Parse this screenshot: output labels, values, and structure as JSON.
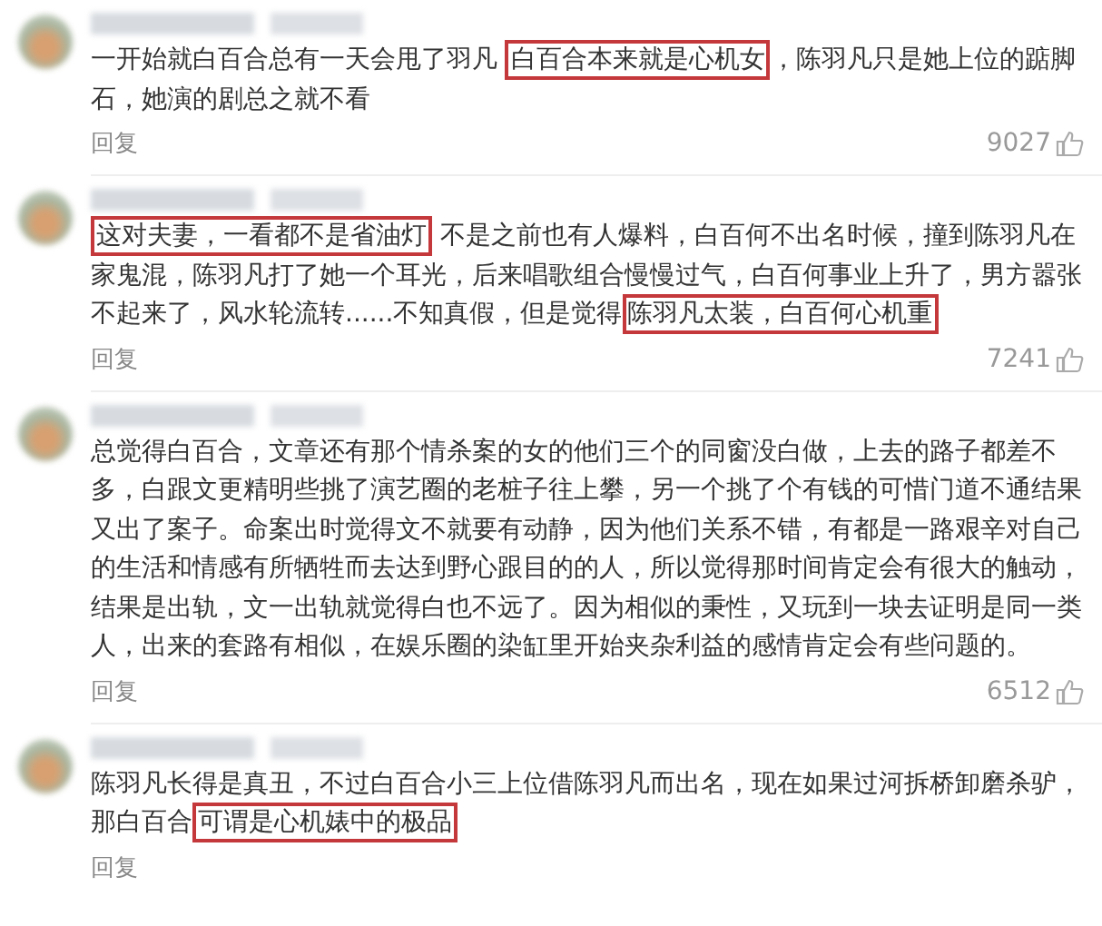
{
  "comments": [
    {
      "segments": [
        {
          "text": "一开始就白百合总有一天会甩了羽凡 ",
          "highlighted": false
        },
        {
          "text": "白百合本来就是心机女",
          "highlighted": true
        },
        {
          "text": "，陈羽凡只是她上位的踮脚石，她演的剧总之就不看",
          "highlighted": false
        }
      ],
      "reply": "回复",
      "likes": "9027"
    },
    {
      "segments": [
        {
          "text": "这对夫妻，一看都不是省油灯",
          "highlighted": true
        },
        {
          "text": " 不是之前也有人爆料，白百何不出名时候，撞到陈羽凡在家鬼混，陈羽凡打了她一个耳光，后来唱歌组合慢慢过气，白百何事业上升了，男方嚣张不起来了，风水轮流转......不知真假，但是觉得",
          "highlighted": false
        },
        {
          "text": "陈羽凡太装，白百何心机重",
          "highlighted": true
        }
      ],
      "reply": "回复",
      "likes": "7241"
    },
    {
      "segments": [
        {
          "text": "总觉得白百合，文章还有那个情杀案的女的他们三个的同窗没白做，上去的路子都差不多，白跟文更精明些挑了演艺圈的老桩子往上攀，另一个挑了个有钱的可惜门道不通结果又出了案子。命案出时觉得文不就要有动静，因为他们关系不错，有都是一路艰辛对自己的生活和情感有所牺牲而去达到野心跟目的的人，所以觉得那时间肯定会有很大的触动，结果是出轨，文一出轨就觉得白也不远了。因为相似的秉性，又玩到一块去证明是同一类人，出来的套路有相似，在娱乐圈的染缸里开始夹杂利益的感情肯定会有些问题的。",
          "highlighted": false
        }
      ],
      "reply": "回复",
      "likes": "6512"
    },
    {
      "segments": [
        {
          "text": "陈羽凡长得是真丑，不过白百合小三上位借陈羽凡而出名，现在如果过河拆桥卸磨杀驴，那白百合",
          "highlighted": false
        },
        {
          "text": "可谓是心机婊中的极品",
          "highlighted": true
        }
      ],
      "reply": "回复"
    }
  ]
}
